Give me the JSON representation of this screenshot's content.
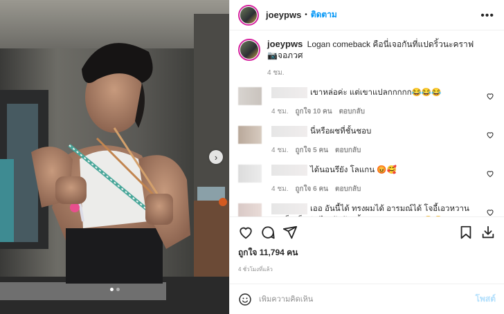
{
  "post": {
    "username": "joeypws",
    "separator": "•",
    "follow_label": "ติดตาม",
    "more_label": "•••"
  },
  "caption": {
    "username": "joeypws",
    "text": "Logan comeback คือนี่เจอกันที่แปดริ้วนะคราฟ",
    "line2": "📷จอภวศ",
    "time": "4 ชม."
  },
  "comments": [
    {
      "text": "เขาหล่อค่ะ แต่เขาแปลกกกกก😂😂😂",
      "time": "4 ชม.",
      "likes": "ถูกใจ 10 คน",
      "reply": "ตอบกลับ"
    },
    {
      "text": "นี่หรือผชที่ชั้นชอบ",
      "time": "4 ชม.",
      "likes": "ถูกใจ 5 คน",
      "reply": "ตอบกลับ"
    },
    {
      "text": "ได้นอนรึยัง โลแกน 😡🥰",
      "time": "4 ชม.",
      "likes": "ถูกใจ 6 คน",
      "reply": "ตอบกลับ"
    },
    {
      "text": "เออ อันนี้ได้ ทรงผมได้ อารมณ์ได้ โจอี้เอวหวาน แม่เห็นเอ็งเดินไปเข้าห้องน้ำ เอวหวานมาเลย 😂😂",
      "time": "",
      "likes": "",
      "reply": ""
    }
  ],
  "actions": {
    "likes": "ถูกใจ 11,794 คน",
    "time": "4 ชั่วโมงที่แล้ว"
  },
  "add_comment": {
    "placeholder": "เพิ่มความคิดเห็น",
    "post_label": "โพสต์"
  },
  "carousel": {
    "current": 1,
    "total": 2
  }
}
